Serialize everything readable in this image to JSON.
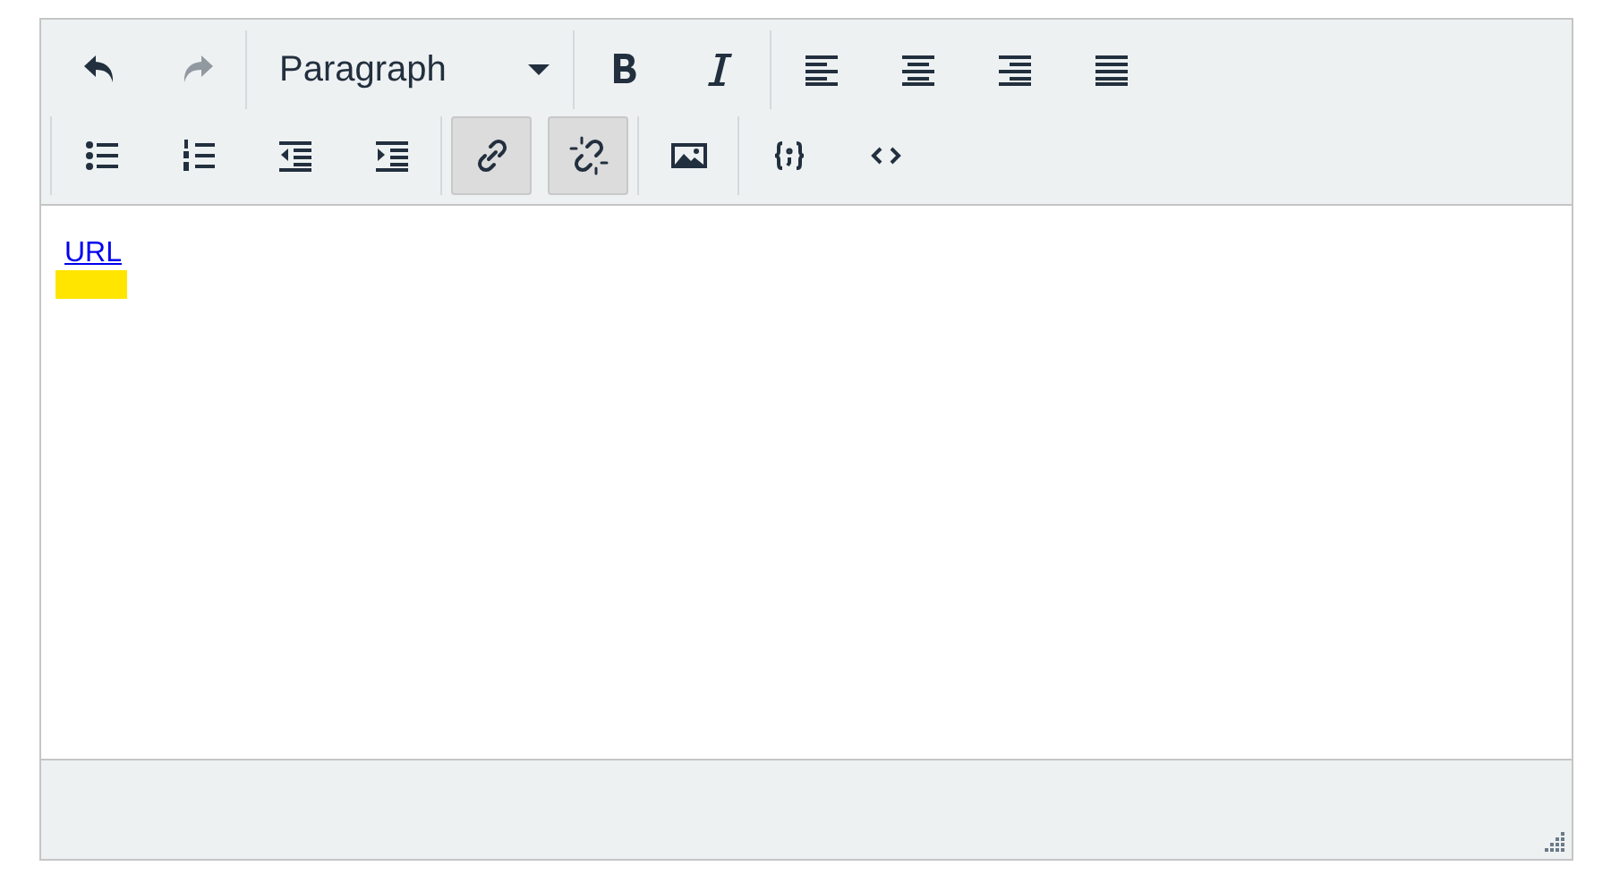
{
  "toolbar": {
    "rows": [
      {
        "groups": [
          [
            {
              "kind": "undo",
              "disabled": false,
              "pressed": false
            },
            {
              "kind": "redo",
              "disabled": true,
              "pressed": false
            }
          ],
          [
            {
              "kind": "select",
              "label": "Paragraph",
              "disabled": false,
              "pressed": false
            }
          ],
          [
            {
              "kind": "bold",
              "disabled": false,
              "pressed": false
            },
            {
              "kind": "italic",
              "disabled": false,
              "pressed": false
            }
          ],
          [
            {
              "kind": "align-left",
              "disabled": false,
              "pressed": false
            },
            {
              "kind": "align-center",
              "disabled": false,
              "pressed": false
            },
            {
              "kind": "align-right",
              "disabled": false,
              "pressed": false
            },
            {
              "kind": "justify",
              "disabled": false,
              "pressed": false
            }
          ]
        ]
      },
      {
        "groups": [
          [
            {
              "kind": "bullet-list",
              "disabled": false,
              "pressed": false
            },
            {
              "kind": "numbered-list",
              "disabled": false,
              "pressed": false
            },
            {
              "kind": "outdent",
              "disabled": false,
              "pressed": false
            },
            {
              "kind": "indent",
              "disabled": false,
              "pressed": false
            }
          ],
          [
            {
              "kind": "link",
              "disabled": false,
              "pressed": true
            },
            {
              "kind": "unlink",
              "disabled": false,
              "pressed": true
            }
          ],
          [
            {
              "kind": "image",
              "disabled": false,
              "pressed": false
            }
          ],
          [
            {
              "kind": "code",
              "disabled": false,
              "pressed": false
            },
            {
              "kind": "source",
              "disabled": false,
              "pressed": false
            }
          ]
        ]
      }
    ]
  },
  "content": {
    "link": {
      "text": "URL",
      "highlighted": true
    }
  }
}
